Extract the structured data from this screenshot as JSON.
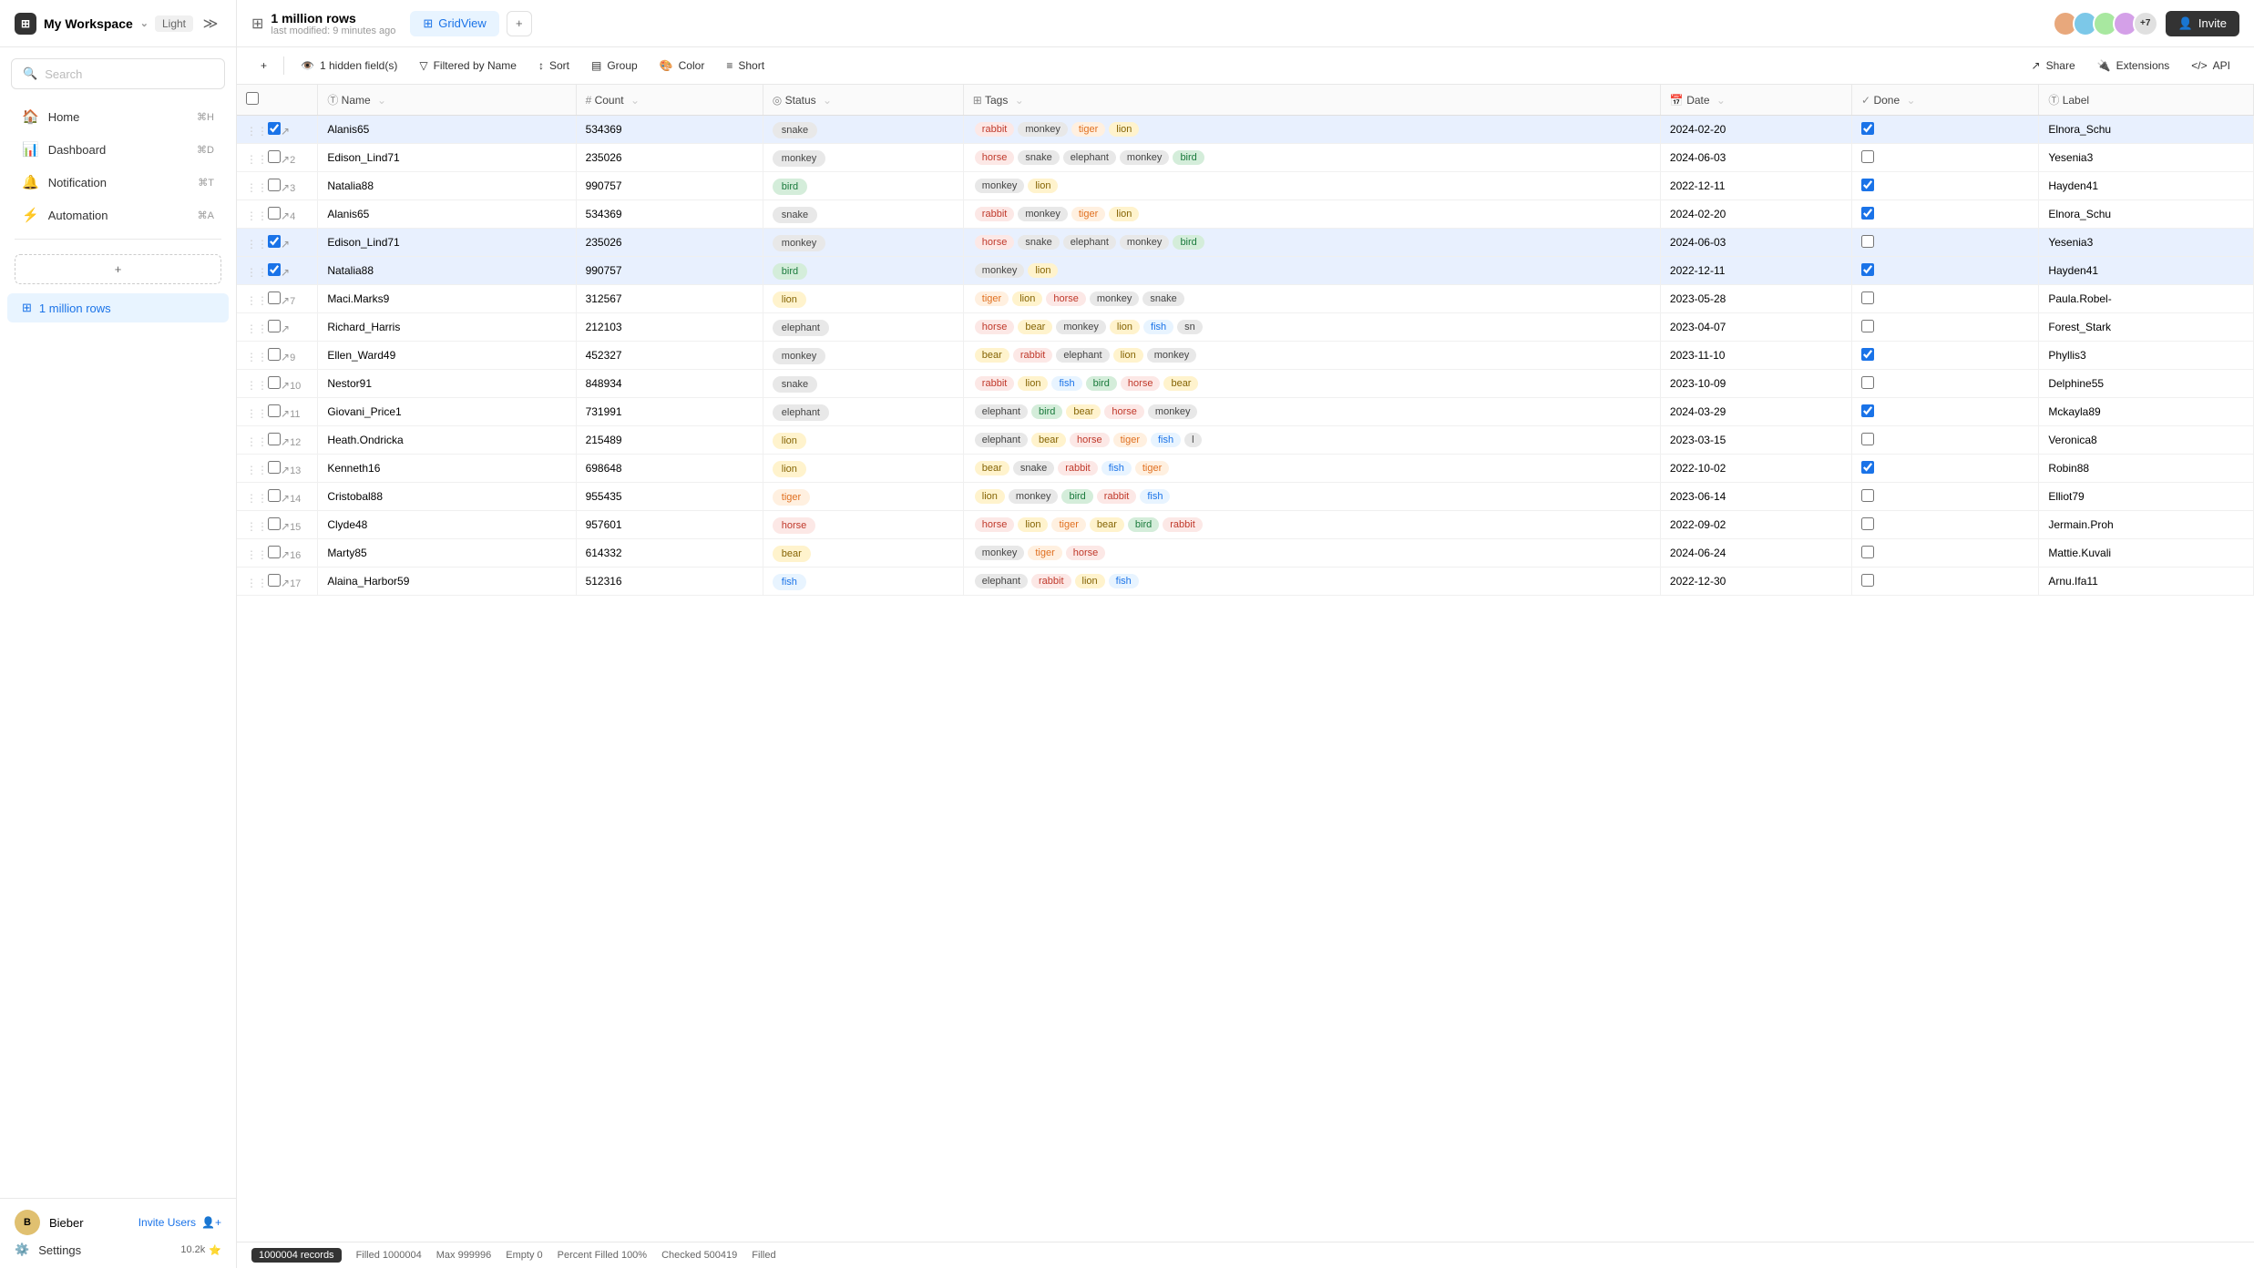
{
  "sidebar": {
    "workspace": "My Workspace",
    "theme": "Light",
    "search_placeholder": "Search",
    "nav_items": [
      {
        "label": "Home",
        "shortcut": "⌘H",
        "icon": "🏠"
      },
      {
        "label": "Dashboard",
        "shortcut": "⌘D",
        "icon": "📊"
      },
      {
        "label": "Notification",
        "shortcut": "⌘T",
        "icon": "🔔"
      },
      {
        "label": "Automation",
        "shortcut": "⌘A",
        "icon": "⚡"
      }
    ],
    "add_table_label": "+",
    "table_name": "1 million rows",
    "user_name": "Bieber",
    "invite_label": "Invite Users",
    "settings_label": "Settings",
    "settings_count": "10.2k"
  },
  "topbar": {
    "table_name": "1 million rows",
    "last_modified": "last modified: 9 minutes ago",
    "view_label": "GridView",
    "invite_label": "Invite"
  },
  "toolbar": {
    "hidden_fields": "1 hidden field(s)",
    "filter": "Filtered by Name",
    "sort": "Sort",
    "group": "Group",
    "color": "Color",
    "short": "Short",
    "share": "Share",
    "extensions": "Extensions",
    "api": "API"
  },
  "table": {
    "columns": [
      "Name",
      "Count",
      "Status",
      "Tags",
      "Date",
      "Done",
      "Label"
    ],
    "rows": [
      {
        "row_num": "",
        "name": "Alanis65",
        "count": "534369",
        "status": "snake",
        "tags": [
          "rabbit",
          "monkey",
          "tiger",
          "lion"
        ],
        "date": "2024-02-20",
        "done": true,
        "label": "Elnora_Schu",
        "selected": true
      },
      {
        "row_num": "2",
        "name": "Edison_Lind71",
        "count": "235026",
        "status": "monkey",
        "tags": [
          "horse",
          "snake",
          "elephant",
          "monkey",
          "bird"
        ],
        "date": "2024-06-03",
        "done": false,
        "label": "Yesenia3",
        "selected": false
      },
      {
        "row_num": "3",
        "name": "Natalia88",
        "count": "990757",
        "status": "bird",
        "tags": [
          "monkey",
          "lion"
        ],
        "date": "2022-12-11",
        "done": true,
        "label": "Hayden41",
        "selected": false
      },
      {
        "row_num": "4",
        "name": "Alanis65",
        "count": "534369",
        "status": "snake",
        "tags": [
          "rabbit",
          "monkey",
          "tiger",
          "lion"
        ],
        "date": "2024-02-20",
        "done": true,
        "label": "Elnora_Schu",
        "selected": false
      },
      {
        "row_num": "",
        "name": "Edison_Lind71",
        "count": "235026",
        "status": "monkey",
        "tags": [
          "horse",
          "snake",
          "elephant",
          "monkey",
          "bird"
        ],
        "date": "2024-06-03",
        "done": false,
        "label": "Yesenia3",
        "selected": true
      },
      {
        "row_num": "",
        "name": "Natalia88",
        "count": "990757",
        "status": "bird",
        "tags": [
          "monkey",
          "lion"
        ],
        "date": "2022-12-11",
        "done": true,
        "label": "Hayden41",
        "selected": true
      },
      {
        "row_num": "7",
        "name": "Maci.Marks9",
        "count": "312567",
        "status": "lion",
        "tags": [
          "tiger",
          "lion",
          "horse",
          "monkey",
          "snake"
        ],
        "date": "2023-05-28",
        "done": false,
        "label": "Paula.Robel-",
        "selected": false
      },
      {
        "row_num": "",
        "name": "Richard_Harris",
        "count": "212103",
        "status": "elephant",
        "tags": [
          "horse",
          "bear",
          "monkey",
          "lion",
          "fish",
          "sn"
        ],
        "date": "2023-04-07",
        "done": false,
        "label": "Forest_Stark",
        "selected": false
      },
      {
        "row_num": "9",
        "name": "Ellen_Ward49",
        "count": "452327",
        "status": "monkey",
        "tags": [
          "bear",
          "rabbit",
          "elephant",
          "lion",
          "monkey"
        ],
        "date": "2023-11-10",
        "done": true,
        "label": "Phyllis3",
        "selected": false
      },
      {
        "row_num": "10",
        "name": "Nestor91",
        "count": "848934",
        "status": "snake",
        "tags": [
          "rabbit",
          "lion",
          "fish",
          "bird",
          "horse",
          "bear"
        ],
        "date": "2023-10-09",
        "done": false,
        "label": "Delphine55",
        "selected": false
      },
      {
        "row_num": "11",
        "name": "Giovani_Price1",
        "count": "731991",
        "status": "elephant",
        "tags": [
          "elephant",
          "bird",
          "bear",
          "horse",
          "monkey"
        ],
        "date": "2024-03-29",
        "done": true,
        "label": "Mckayla89",
        "selected": false
      },
      {
        "row_num": "12",
        "name": "Heath.Ondricka",
        "count": "215489",
        "status": "lion",
        "tags": [
          "elephant",
          "bear",
          "horse",
          "tiger",
          "fish",
          "l"
        ],
        "date": "2023-03-15",
        "done": false,
        "label": "Veronica8",
        "selected": false
      },
      {
        "row_num": "13",
        "name": "Kenneth16",
        "count": "698648",
        "status": "lion",
        "tags": [
          "bear",
          "snake",
          "rabbit",
          "fish",
          "tiger"
        ],
        "date": "2022-10-02",
        "done": true,
        "label": "Robin88",
        "selected": false
      },
      {
        "row_num": "14",
        "name": "Cristobal88",
        "count": "955435",
        "status": "tiger",
        "tags": [
          "lion",
          "monkey",
          "bird",
          "rabbit",
          "fish"
        ],
        "date": "2023-06-14",
        "done": false,
        "label": "Elliot79",
        "selected": false
      },
      {
        "row_num": "15",
        "name": "Clyde48",
        "count": "957601",
        "status": "horse",
        "tags": [
          "horse",
          "lion",
          "tiger",
          "bear",
          "bird",
          "rabbit"
        ],
        "date": "2022-09-02",
        "done": false,
        "label": "Jermain.Proh",
        "selected": false
      },
      {
        "row_num": "16",
        "name": "Marty85",
        "count": "614332",
        "status": "bear",
        "tags": [
          "monkey",
          "tiger",
          "horse"
        ],
        "date": "2024-06-24",
        "done": false,
        "label": "Mattie.Kuvali",
        "selected": false
      },
      {
        "row_num": "17",
        "name": "Alaina_Harbor59",
        "count": "512316",
        "status": "fish",
        "tags": [
          "elephant",
          "rabbit",
          "lion",
          "fish"
        ],
        "date": "2022-12-30",
        "done": false,
        "label": "Arnu.Ifa11",
        "selected": false
      }
    ]
  },
  "statusbar": {
    "records": "1000004 records",
    "filled": "Filled 1000004",
    "max": "Max 999996",
    "empty": "Empty 0",
    "percent": "Percent Filled 100%",
    "checked": "Checked 500419",
    "filled_label": "Filled"
  }
}
